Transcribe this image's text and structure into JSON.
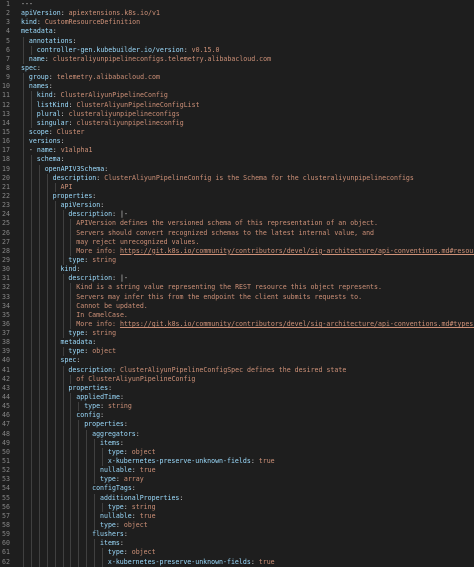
{
  "editor": {
    "lines": [
      {
        "n": "1",
        "indent": 0,
        "parts": [
          {
            "t": "---",
            "c": "p"
          }
        ]
      },
      {
        "n": "2",
        "indent": 0,
        "parts": [
          {
            "t": "apiVersion",
            "c": "k"
          },
          {
            "t": ": ",
            "c": "p"
          },
          {
            "t": "apiextensions.k8s.io/v1",
            "c": "v"
          }
        ]
      },
      {
        "n": "3",
        "indent": 0,
        "parts": [
          {
            "t": "kind",
            "c": "k"
          },
          {
            "t": ": ",
            "c": "p"
          },
          {
            "t": "CustomResourceDefinition",
            "c": "v"
          }
        ]
      },
      {
        "n": "4",
        "indent": 0,
        "parts": [
          {
            "t": "metadata",
            "c": "k"
          },
          {
            "t": ":",
            "c": "p"
          }
        ]
      },
      {
        "n": "5",
        "indent": 1,
        "parts": [
          {
            "t": "annotations",
            "c": "k"
          },
          {
            "t": ":",
            "c": "p"
          }
        ]
      },
      {
        "n": "6",
        "indent": 2,
        "parts": [
          {
            "t": "controller-gen.kubebuilder.io/version",
            "c": "k"
          },
          {
            "t": ": ",
            "c": "p"
          },
          {
            "t": "v0.15.0",
            "c": "v"
          }
        ]
      },
      {
        "n": "7",
        "indent": 1,
        "parts": [
          {
            "t": "name",
            "c": "k"
          },
          {
            "t": ": ",
            "c": "p"
          },
          {
            "t": "clusteraliyunpipelineconfigs.telemetry.alibabacloud.com",
            "c": "v"
          }
        ]
      },
      {
        "n": "8",
        "indent": 0,
        "parts": [
          {
            "t": "spec",
            "c": "k"
          },
          {
            "t": ":",
            "c": "p"
          }
        ]
      },
      {
        "n": "9",
        "indent": 1,
        "parts": [
          {
            "t": "group",
            "c": "k"
          },
          {
            "t": ": ",
            "c": "p"
          },
          {
            "t": "telemetry.alibabacloud.com",
            "c": "v"
          }
        ]
      },
      {
        "n": "10",
        "indent": 1,
        "parts": [
          {
            "t": "names",
            "c": "k"
          },
          {
            "t": ":",
            "c": "p"
          }
        ]
      },
      {
        "n": "11",
        "indent": 2,
        "parts": [
          {
            "t": "kind",
            "c": "k"
          },
          {
            "t": ": ",
            "c": "p"
          },
          {
            "t": "ClusterAliyunPipelineConfig",
            "c": "v"
          }
        ]
      },
      {
        "n": "12",
        "indent": 2,
        "parts": [
          {
            "t": "listKind",
            "c": "k"
          },
          {
            "t": ": ",
            "c": "p"
          },
          {
            "t": "ClusterAliyunPipelineConfigList",
            "c": "v"
          }
        ]
      },
      {
        "n": "13",
        "indent": 2,
        "parts": [
          {
            "t": "plural",
            "c": "k"
          },
          {
            "t": ": ",
            "c": "p"
          },
          {
            "t": "clusteraliyunpipelineconfigs",
            "c": "v"
          }
        ]
      },
      {
        "n": "14",
        "indent": 2,
        "parts": [
          {
            "t": "singular",
            "c": "k"
          },
          {
            "t": ": ",
            "c": "p"
          },
          {
            "t": "clusteraliyunpipelineconfig",
            "c": "v"
          }
        ]
      },
      {
        "n": "15",
        "indent": 1,
        "parts": [
          {
            "t": "scope",
            "c": "k"
          },
          {
            "t": ": ",
            "c": "p"
          },
          {
            "t": "Cluster",
            "c": "v"
          }
        ]
      },
      {
        "n": "16",
        "indent": 1,
        "parts": [
          {
            "t": "versions",
            "c": "k"
          },
          {
            "t": ":",
            "c": "p"
          }
        ]
      },
      {
        "n": "17",
        "indent": 1,
        "parts": [
          {
            "t": "- ",
            "c": "p"
          },
          {
            "t": "name",
            "c": "k"
          },
          {
            "t": ": ",
            "c": "p"
          },
          {
            "t": "v1alpha1",
            "c": "v"
          }
        ]
      },
      {
        "n": "18",
        "indent": 2,
        "parts": [
          {
            "t": "schema",
            "c": "k"
          },
          {
            "t": ":",
            "c": "p"
          }
        ]
      },
      {
        "n": "19",
        "indent": 3,
        "parts": [
          {
            "t": "openAPIV3Schema",
            "c": "k"
          },
          {
            "t": ":",
            "c": "p"
          }
        ]
      },
      {
        "n": "20",
        "indent": 4,
        "parts": [
          {
            "t": "description",
            "c": "k"
          },
          {
            "t": ": ",
            "c": "p"
          },
          {
            "t": "ClusterAliyunPipelineConfig is the Schema for the clusteraliyunpipelineconfigs",
            "c": "v"
          }
        ]
      },
      {
        "n": "21",
        "indent": 5,
        "parts": [
          {
            "t": "API",
            "c": "v"
          }
        ]
      },
      {
        "n": "22",
        "indent": 4,
        "parts": [
          {
            "t": "properties",
            "c": "k"
          },
          {
            "t": ":",
            "c": "p"
          }
        ]
      },
      {
        "n": "23",
        "indent": 5,
        "parts": [
          {
            "t": "apiVersion",
            "c": "k"
          },
          {
            "t": ":",
            "c": "p"
          }
        ]
      },
      {
        "n": "24",
        "indent": 6,
        "parts": [
          {
            "t": "description",
            "c": "k"
          },
          {
            "t": ": ",
            "c": "p"
          },
          {
            "t": "|-",
            "c": "p"
          }
        ]
      },
      {
        "n": "25",
        "indent": 7,
        "parts": [
          {
            "t": "APIVersion defines the versioned schema of this representation of an object.",
            "c": "v"
          }
        ]
      },
      {
        "n": "26",
        "indent": 7,
        "parts": [
          {
            "t": "Servers should convert recognized schemas to the latest internal value, and",
            "c": "v"
          }
        ]
      },
      {
        "n": "27",
        "indent": 7,
        "parts": [
          {
            "t": "may reject unrecognized values.",
            "c": "v"
          }
        ]
      },
      {
        "n": "28",
        "indent": 7,
        "parts": [
          {
            "t": "More info: ",
            "c": "v"
          },
          {
            "t": "https://git.k8s.io/community/contributors/devel/sig-architecture/api-conventions.md#resources",
            "c": "u"
          }
        ]
      },
      {
        "n": "29",
        "indent": 6,
        "parts": [
          {
            "t": "type",
            "c": "k"
          },
          {
            "t": ": ",
            "c": "p"
          },
          {
            "t": "string",
            "c": "v"
          }
        ]
      },
      {
        "n": "30",
        "indent": 5,
        "parts": [
          {
            "t": "kind",
            "c": "k"
          },
          {
            "t": ":",
            "c": "p"
          }
        ]
      },
      {
        "n": "31",
        "indent": 6,
        "parts": [
          {
            "t": "description",
            "c": "k"
          },
          {
            "t": ": ",
            "c": "p"
          },
          {
            "t": "|-",
            "c": "p"
          }
        ]
      },
      {
        "n": "32",
        "indent": 7,
        "parts": [
          {
            "t": "Kind is a string value representing the REST resource this object represents.",
            "c": "v"
          }
        ]
      },
      {
        "n": "33",
        "indent": 7,
        "parts": [
          {
            "t": "Servers may infer this from the endpoint the client submits requests to.",
            "c": "v"
          }
        ]
      },
      {
        "n": "34",
        "indent": 7,
        "parts": [
          {
            "t": "Cannot be updated.",
            "c": "v"
          }
        ]
      },
      {
        "n": "35",
        "indent": 7,
        "parts": [
          {
            "t": "In CamelCase.",
            "c": "v"
          }
        ]
      },
      {
        "n": "36",
        "indent": 7,
        "parts": [
          {
            "t": "More info: ",
            "c": "v"
          },
          {
            "t": "https://git.k8s.io/community/contributors/devel/sig-architecture/api-conventions.md#types-kinds",
            "c": "u"
          }
        ]
      },
      {
        "n": "37",
        "indent": 6,
        "parts": [
          {
            "t": "type",
            "c": "k"
          },
          {
            "t": ": ",
            "c": "p"
          },
          {
            "t": "string",
            "c": "v"
          }
        ]
      },
      {
        "n": "38",
        "indent": 5,
        "parts": [
          {
            "t": "metadata",
            "c": "k"
          },
          {
            "t": ":",
            "c": "p"
          }
        ]
      },
      {
        "n": "39",
        "indent": 6,
        "parts": [
          {
            "t": "type",
            "c": "k"
          },
          {
            "t": ": ",
            "c": "p"
          },
          {
            "t": "object",
            "c": "v"
          }
        ]
      },
      {
        "n": "40",
        "indent": 5,
        "parts": [
          {
            "t": "spec",
            "c": "k"
          },
          {
            "t": ":",
            "c": "p"
          }
        ]
      },
      {
        "n": "41",
        "indent": 6,
        "parts": [
          {
            "t": "description",
            "c": "k"
          },
          {
            "t": ": ",
            "c": "p"
          },
          {
            "t": "ClusterAliyunPipelineConfigSpec defines the desired state",
            "c": "v"
          }
        ]
      },
      {
        "n": "42",
        "indent": 7,
        "parts": [
          {
            "t": "of ClusterAliyunPipelineConfig",
            "c": "v"
          }
        ]
      },
      {
        "n": "43",
        "indent": 6,
        "parts": [
          {
            "t": "properties",
            "c": "k"
          },
          {
            "t": ":",
            "c": "p"
          }
        ]
      },
      {
        "n": "44",
        "indent": 7,
        "parts": [
          {
            "t": "appliedTime",
            "c": "k"
          },
          {
            "t": ":",
            "c": "p"
          }
        ]
      },
      {
        "n": "45",
        "indent": 8,
        "parts": [
          {
            "t": "type",
            "c": "k"
          },
          {
            "t": ": ",
            "c": "p"
          },
          {
            "t": "string",
            "c": "v"
          }
        ]
      },
      {
        "n": "46",
        "indent": 7,
        "parts": [
          {
            "t": "config",
            "c": "k"
          },
          {
            "t": ":",
            "c": "p"
          }
        ]
      },
      {
        "n": "47",
        "indent": 8,
        "parts": [
          {
            "t": "properties",
            "c": "k"
          },
          {
            "t": ":",
            "c": "p"
          }
        ]
      },
      {
        "n": "48",
        "indent": 9,
        "parts": [
          {
            "t": "aggregators",
            "c": "k"
          },
          {
            "t": ":",
            "c": "p"
          }
        ]
      },
      {
        "n": "49",
        "indent": 10,
        "parts": [
          {
            "t": "items",
            "c": "k"
          },
          {
            "t": ":",
            "c": "p"
          }
        ]
      },
      {
        "n": "50",
        "indent": 11,
        "parts": [
          {
            "t": "type",
            "c": "k"
          },
          {
            "t": ": ",
            "c": "p"
          },
          {
            "t": "object",
            "c": "v"
          }
        ]
      },
      {
        "n": "51",
        "indent": 11,
        "parts": [
          {
            "t": "x-kubernetes-preserve-unknown-fields",
            "c": "k"
          },
          {
            "t": ": ",
            "c": "p"
          },
          {
            "t": "true",
            "c": "v"
          }
        ]
      },
      {
        "n": "52",
        "indent": 10,
        "parts": [
          {
            "t": "nullable",
            "c": "k"
          },
          {
            "t": ": ",
            "c": "p"
          },
          {
            "t": "true",
            "c": "v"
          }
        ]
      },
      {
        "n": "53",
        "indent": 10,
        "parts": [
          {
            "t": "type",
            "c": "k"
          },
          {
            "t": ": ",
            "c": "p"
          },
          {
            "t": "array",
            "c": "v"
          }
        ]
      },
      {
        "n": "54",
        "indent": 9,
        "parts": [
          {
            "t": "configTags",
            "c": "k"
          },
          {
            "t": ":",
            "c": "p"
          }
        ]
      },
      {
        "n": "55",
        "indent": 10,
        "parts": [
          {
            "t": "additionalProperties",
            "c": "k"
          },
          {
            "t": ":",
            "c": "p"
          }
        ]
      },
      {
        "n": "56",
        "indent": 11,
        "parts": [
          {
            "t": "type",
            "c": "k"
          },
          {
            "t": ": ",
            "c": "p"
          },
          {
            "t": "string",
            "c": "v"
          }
        ]
      },
      {
        "n": "57",
        "indent": 10,
        "parts": [
          {
            "t": "nullable",
            "c": "k"
          },
          {
            "t": ": ",
            "c": "p"
          },
          {
            "t": "true",
            "c": "v"
          }
        ]
      },
      {
        "n": "58",
        "indent": 10,
        "parts": [
          {
            "t": "type",
            "c": "k"
          },
          {
            "t": ": ",
            "c": "p"
          },
          {
            "t": "object",
            "c": "v"
          }
        ]
      },
      {
        "n": "59",
        "indent": 9,
        "parts": [
          {
            "t": "flushers",
            "c": "k"
          },
          {
            "t": ":",
            "c": "p"
          }
        ]
      },
      {
        "n": "60",
        "indent": 10,
        "parts": [
          {
            "t": "items",
            "c": "k"
          },
          {
            "t": ":",
            "c": "p"
          }
        ]
      },
      {
        "n": "61",
        "indent": 11,
        "parts": [
          {
            "t": "type",
            "c": "k"
          },
          {
            "t": ": ",
            "c": "p"
          },
          {
            "t": "object",
            "c": "v"
          }
        ]
      },
      {
        "n": "62",
        "indent": 11,
        "parts": [
          {
            "t": "x-kubernetes-preserve-unknown-fields",
            "c": "k"
          },
          {
            "t": ": ",
            "c": "p"
          },
          {
            "t": "true",
            "c": "v"
          }
        ]
      }
    ]
  }
}
